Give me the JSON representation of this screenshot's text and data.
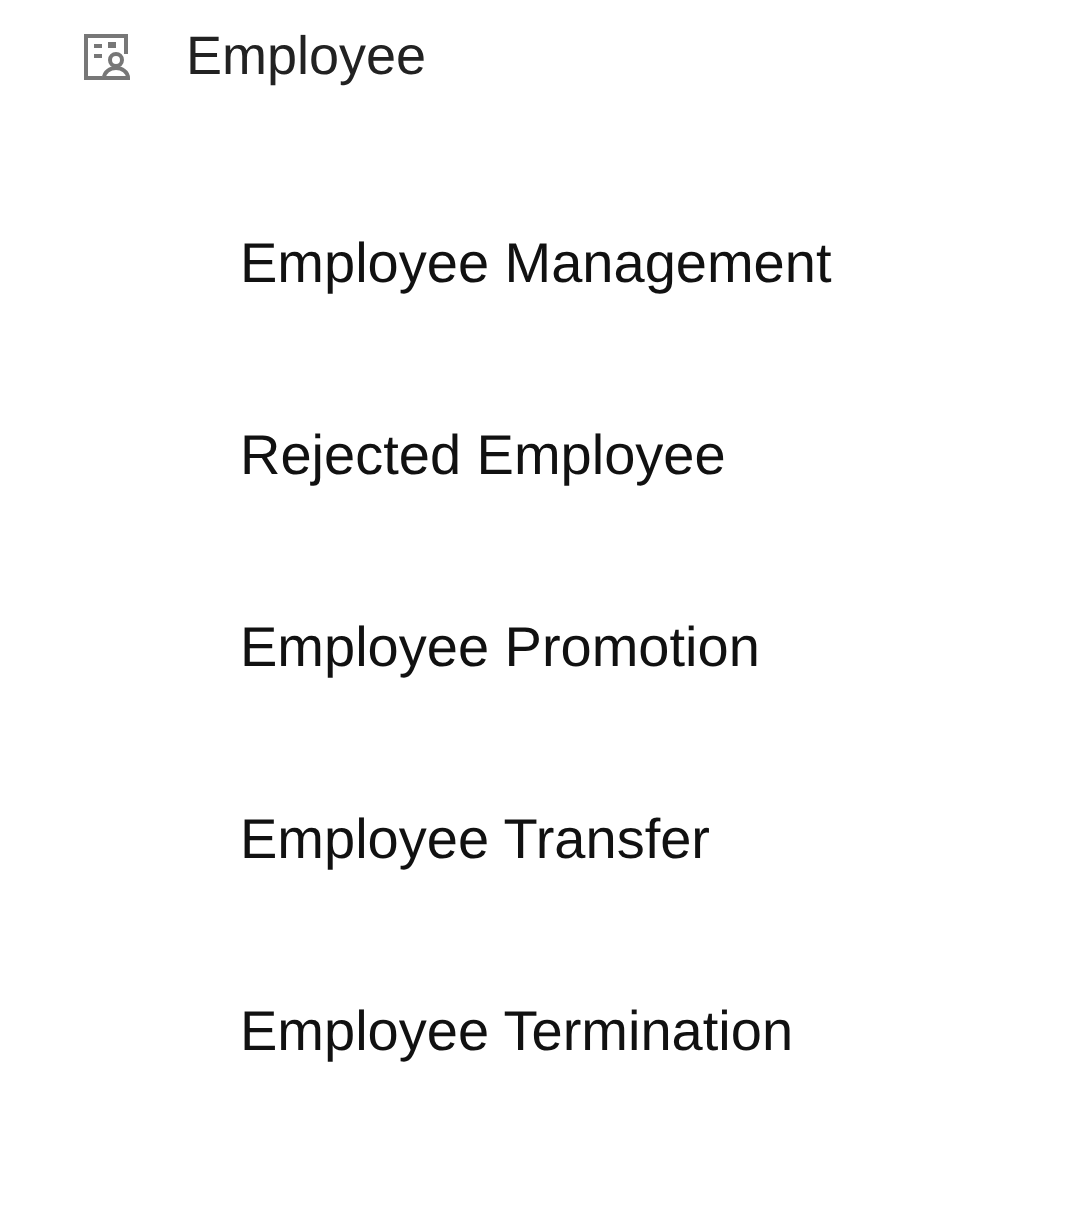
{
  "menu": {
    "title": "Employee",
    "items": [
      {
        "label": "Employee Management"
      },
      {
        "label": "Rejected Employee"
      },
      {
        "label": "Employee Promotion"
      },
      {
        "label": "Employee Transfer"
      },
      {
        "label": "Employee Termination"
      }
    ]
  }
}
